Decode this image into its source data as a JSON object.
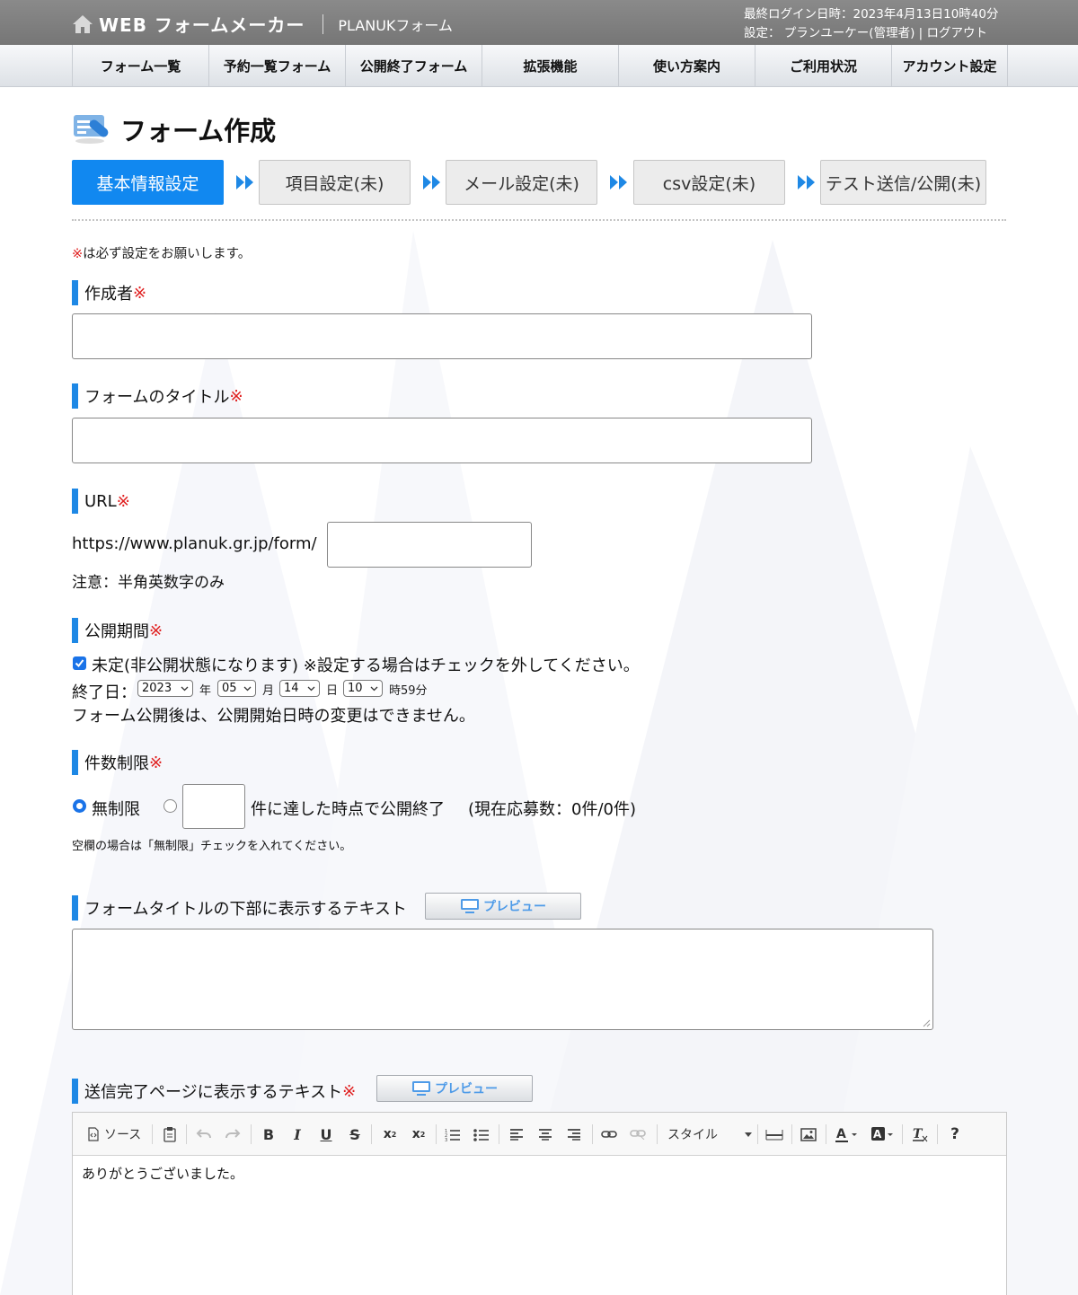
{
  "header": {
    "brand": "WEB フォームメーカー",
    "subtitle": "PLANUKフォーム",
    "last_login": "最終ログイン日時：2023年4月13日10時40分",
    "settings_prefix": "設定：",
    "user": "プランユーケー(管理者)",
    "divider": "|",
    "logout": "ログアウト"
  },
  "nav": [
    "フォーム一覧",
    "予約一覧フォーム",
    "公開終了フォーム",
    "拡張機能",
    "使い方案内",
    "ご利用状況",
    "アカウント設定"
  ],
  "page_title": "フォーム作成",
  "steps": [
    "基本情報設定",
    "項目設定(未)",
    "メール設定(未)",
    "csv設定(未)",
    "テスト送信/公開(未)"
  ],
  "required_mark": "※",
  "required_note": "は必ず設定をお願いします。",
  "author": {
    "label": "作成者",
    "value": ""
  },
  "form_title": {
    "label": "フォームのタイトル",
    "value": ""
  },
  "url": {
    "label": "URL",
    "prefix": "https://www.planuk.gr.jp/form/",
    "value": "",
    "note": "注意：半角英数字のみ"
  },
  "period": {
    "label": "公開期間",
    "undecided_checked": true,
    "undecided_text": "未定(非公開状態になります) ※設定する場合はチェックを外してください。",
    "end_label": "終了日：",
    "year": "2023",
    "year_unit": "年",
    "month": "05",
    "month_unit": "月",
    "day": "14",
    "day_unit": "日",
    "hour": "10",
    "hour_unit": "時59分",
    "warning": "フォーム公開後は、公開開始日時の変更はできません。"
  },
  "limit": {
    "label": "件数制限",
    "unlimited_label": "無制限",
    "unlimited_selected": true,
    "count_value": "",
    "count_suffix": "件に達した時点で公開終了",
    "current": "(現在応募数：0件/0件)",
    "note": "空欄の場合は「無制限」チェックを入れてください。"
  },
  "subtitle_text": {
    "label": "フォームタイトルの下部に表示するテキスト",
    "preview": "プレビュー",
    "value": ""
  },
  "complete_text": {
    "label": "送信完了ページに表示するテキスト",
    "preview": "プレビュー",
    "toolbar_source": "ソース",
    "toolbar_style": "スタイル",
    "toolbar_help": "?",
    "body": "ありがとうございました。"
  },
  "colors": {
    "accent": "#1188f0",
    "required": "#e02020",
    "header_bg": "#808080"
  }
}
